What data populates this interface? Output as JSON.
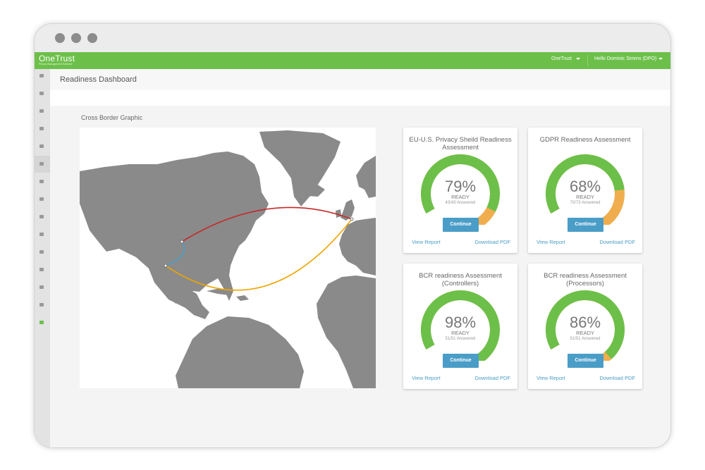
{
  "topbar": {
    "brand": "OneTrust",
    "brand_sub": "Privacy Management Software",
    "org_menu": "OneTrust",
    "user_menu": "Hello Dominic Simms (DPO)"
  },
  "header": {
    "title": "Readiness Dashboard"
  },
  "map_section": {
    "title": "Cross Border Graphic"
  },
  "cards": [
    {
      "title": "EU-U.S. Privacy Sheild Readiness Assessment",
      "percent": "79%",
      "percent_value": 79,
      "ready": "READY",
      "answered": "43/43 Answered",
      "button": "Continue",
      "view": "View Report",
      "download": "Download PDF"
    },
    {
      "title": "GDPR Readiness Assessment",
      "percent": "68%",
      "percent_value": 68,
      "ready": "READY",
      "answered": "70/73 Answered",
      "button": "Continue",
      "view": "View Report",
      "download": "Download PDF"
    },
    {
      "title": "BCR readiness Assessment (Controllers)",
      "percent": "98%",
      "percent_value": 98,
      "ready": "READY",
      "answered": "51/51 Answered",
      "button": "Continue",
      "view": "View Report",
      "download": "Download PDF"
    },
    {
      "title": "BCR readiness Assessment (Processors)",
      "percent": "86%",
      "percent_value": 86,
      "ready": "READY",
      "answered": "51/51 Answered",
      "button": "Continue",
      "view": "View Report",
      "download": "Download PDF"
    }
  ],
  "colors": {
    "brand_green": "#6cc04a",
    "gauge_remaining": "#f0ad4e",
    "button_blue": "#4a9dc7",
    "route_red": "#c62828",
    "route_orange": "#f0a500",
    "route_blue": "#4a9dc7",
    "land": "#8a8a8a"
  },
  "sidebar_icons": [
    "home-icon",
    "check-icon",
    "document-icon",
    "grid-icon",
    "briefcase-icon",
    "globe-icon",
    "list-icon",
    "flag-icon",
    "folder-icon",
    "code-icon",
    "user-icon",
    "users-icon",
    "help-icon",
    "settings-icon",
    "megaphone-icon"
  ]
}
